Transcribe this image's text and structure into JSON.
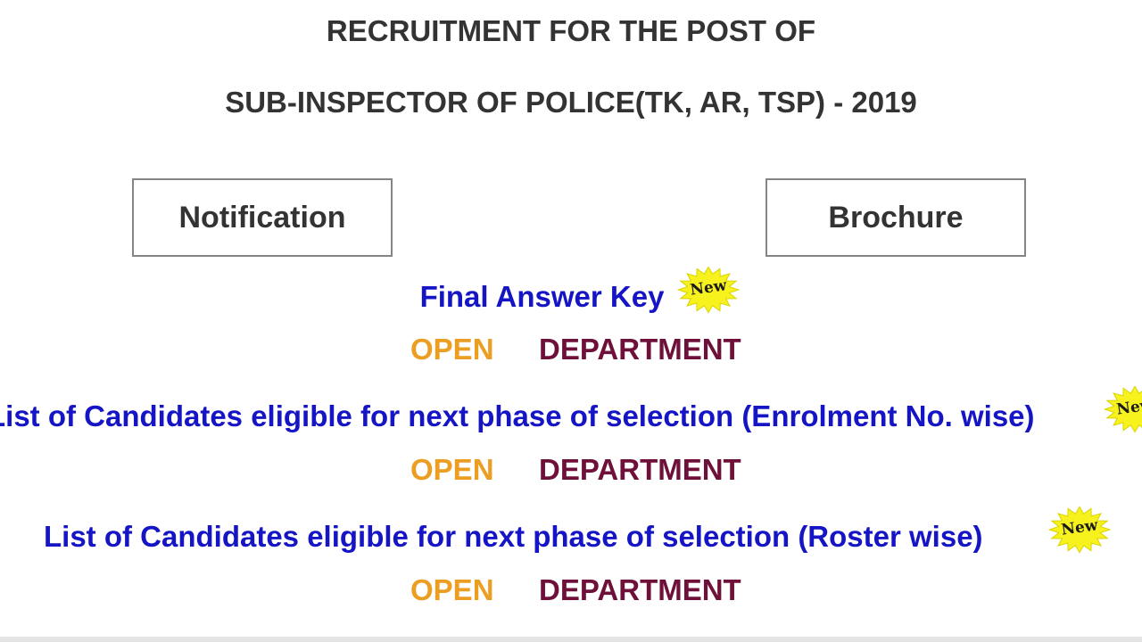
{
  "header": {
    "line1": "RECRUITMENT FOR THE POST OF",
    "line2": "SUB-INSPECTOR OF POLICE(TK, AR, TSP) - 2019"
  },
  "buttons": {
    "notification": "Notification",
    "brochure": "Brochure"
  },
  "entries": [
    {
      "title": "Final Answer Key",
      "badge": "New",
      "open_label": "OPEN",
      "department_label": "DEPARTMENT"
    },
    {
      "title": "List of Candidates eligible for next phase of selection (Enrolment No. wise)",
      "badge": "New",
      "open_label": "OPEN",
      "department_label": "DEPARTMENT"
    },
    {
      "title": "List of Candidates eligible for next phase of selection (Roster wise)",
      "badge": "New",
      "open_label": "OPEN",
      "department_label": "DEPARTMENT"
    }
  ],
  "colors": {
    "heading": "#333333",
    "entry_title": "#1515c6",
    "open_link": "#eb9e22",
    "department_link": "#6e1039",
    "badge_fill": "#f7f21e",
    "button_border": "#858585"
  },
  "icons": {
    "badge": "new-starburst-icon"
  }
}
